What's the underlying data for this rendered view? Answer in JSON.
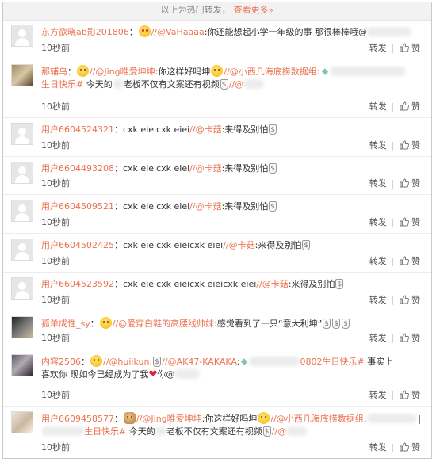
{
  "banner": {
    "text": "以上为热门转发，",
    "more": "查看更多»"
  },
  "actions": {
    "repost": "转发",
    "sep": "|",
    "like": "赞"
  },
  "comments": [
    {
      "avatar": "def",
      "user": "东方欲晓ab影201806",
      "time": "10秒前",
      "segments": [
        {
          "k": "sep",
          "t": "："
        },
        {
          "k": "emoji",
          "e": "love"
        },
        {
          "k": "tag",
          "t": "//@VaHaaaa"
        },
        {
          "k": "plain",
          "t": ":你还能想起小学一年级的事 那很棒棒哦@"
        },
        {
          "k": "blur",
          "w": 56
        }
      ]
    },
    {
      "avatar": "img1",
      "user": "那辅乌",
      "time": "10秒前",
      "two": true,
      "segments": [
        {
          "k": "sep",
          "t": "："
        },
        {
          "k": "emoji",
          "e": "smile"
        },
        {
          "k": "tag",
          "t": "//@Jing唯爱坤坤"
        },
        {
          "k": "plain",
          "t": ":你这样好吗坤"
        },
        {
          "k": "emoji",
          "e": "smile"
        },
        {
          "k": "tag",
          "t": "//@小西几海底捞数据组"
        },
        {
          "k": "plain",
          "t": ":"
        },
        {
          "k": "gem"
        },
        {
          "k": "blur",
          "w": 96
        }
      ],
      "line2": [
        {
          "k": "tag",
          "t": "生日快乐#"
        },
        {
          "k": "plain",
          "t": "  今天的"
        },
        {
          "k": "blur",
          "w": 14
        },
        {
          "k": "plain",
          "t": "老板不仅有文案还有视频"
        },
        {
          "k": "dollar"
        },
        {
          "k": "tag",
          "t": "//@"
        },
        {
          "k": "blur",
          "w": 26
        }
      ]
    },
    {
      "avatar": "def",
      "user": "用户6604524321",
      "time": "10秒前",
      "segments": [
        {
          "k": "plain",
          "t": "：cxk eieicxk eiei"
        },
        {
          "k": "tag",
          "t": "//@卡菇"
        },
        {
          "k": "plain",
          "t": ":来得及别怕"
        },
        {
          "k": "dollar"
        }
      ]
    },
    {
      "avatar": "def",
      "user": "用户6604493208",
      "time": "10秒前",
      "segments": [
        {
          "k": "plain",
          "t": "：cxk eieicxk eiei"
        },
        {
          "k": "tag",
          "t": "//@卡菇"
        },
        {
          "k": "plain",
          "t": ":来得及别怕"
        },
        {
          "k": "dollar"
        }
      ]
    },
    {
      "avatar": "def",
      "user": "用户6604509521",
      "time": "10秒前",
      "segments": [
        {
          "k": "plain",
          "t": "：cxk eieicxk eiei"
        },
        {
          "k": "tag",
          "t": "//@卡菇"
        },
        {
          "k": "plain",
          "t": ":来得及别怕"
        },
        {
          "k": "dollar"
        }
      ]
    },
    {
      "avatar": "def",
      "user": "用户6604502425",
      "time": "10秒前",
      "segments": [
        {
          "k": "plain",
          "t": "：cxk eieicxk eieicxk eiei"
        },
        {
          "k": "tag",
          "t": "//@卡菇"
        },
        {
          "k": "plain",
          "t": ":来得及别怕"
        },
        {
          "k": "dollar"
        }
      ]
    },
    {
      "avatar": "def",
      "user": "用户6604523592",
      "time": "10秒前",
      "segments": [
        {
          "k": "plain",
          "t": "：cxk eieicxk eieicxk eieicxk eiei"
        },
        {
          "k": "tag",
          "t": "//@卡菇"
        },
        {
          "k": "plain",
          "t": ":来得及别怕"
        },
        {
          "k": "dollar"
        }
      ]
    },
    {
      "avatar": "img2",
      "user": "孤单成性_sy",
      "time": "10秒前",
      "segments": [
        {
          "k": "sep",
          "t": "："
        },
        {
          "k": "emoji",
          "e": "smile"
        },
        {
          "k": "tag",
          "t": "//@爱穿白鞋的高腰线帅妹"
        },
        {
          "k": "plain",
          "t": ":感觉看到了一只“意大利坤”"
        },
        {
          "k": "dollar"
        },
        {
          "k": "dollar"
        },
        {
          "k": "dollar"
        }
      ]
    },
    {
      "avatar": "img3",
      "user": "内容2506",
      "time": "10秒前",
      "two": true,
      "segments": [
        {
          "k": "sep",
          "t": "："
        },
        {
          "k": "emoji",
          "e": "smile"
        },
        {
          "k": "tag",
          "t": "//@huiikun"
        },
        {
          "k": "plain",
          "t": ":"
        },
        {
          "k": "dollar"
        },
        {
          "k": "tag",
          "t": "//@AK47-KAKAKA"
        },
        {
          "k": "plain",
          "t": ":"
        },
        {
          "k": "gem"
        },
        {
          "k": "blur",
          "w": 64
        },
        {
          "k": "tag",
          "t": "0802生日快乐#"
        },
        {
          "k": "plain",
          "t": " 事实上"
        }
      ],
      "line2": [
        {
          "k": "plain",
          "t": "喜欢你 现如今已经成为了我"
        },
        {
          "k": "heart",
          "t": "❤"
        },
        {
          "k": "plain",
          "t": "你@"
        },
        {
          "k": "blur",
          "w": 32
        }
      ]
    },
    {
      "avatar": "img4",
      "user": "用户6609458577",
      "time": "10秒前",
      "two": true,
      "segments": [
        {
          "k": "sep",
          "t": "："
        },
        {
          "k": "emoji",
          "e": "cat"
        },
        {
          "k": "tag",
          "t": "//@Jing唯爱坤坤"
        },
        {
          "k": "plain",
          "t": ":你这样好吗坤"
        },
        {
          "k": "emoji",
          "e": "smile"
        },
        {
          "k": "tag",
          "t": "//@小西几海底捞数据组"
        },
        {
          "k": "plain",
          "t": ":"
        },
        {
          "k": "blur",
          "w": 62
        },
        {
          "k": "plain",
          "t": " | #"
        }
      ],
      "line2": [
        {
          "k": "blur",
          "w": 54
        },
        {
          "k": "tag",
          "t": "生日快乐#"
        },
        {
          "k": "plain",
          "t": "  今天的"
        },
        {
          "k": "blur",
          "w": 14
        },
        {
          "k": "plain",
          "t": "老板不仅有文案还有视频"
        },
        {
          "k": "dollar"
        },
        {
          "k": "tag",
          "t": "//@"
        },
        {
          "k": "blur",
          "w": 26
        }
      ]
    }
  ]
}
